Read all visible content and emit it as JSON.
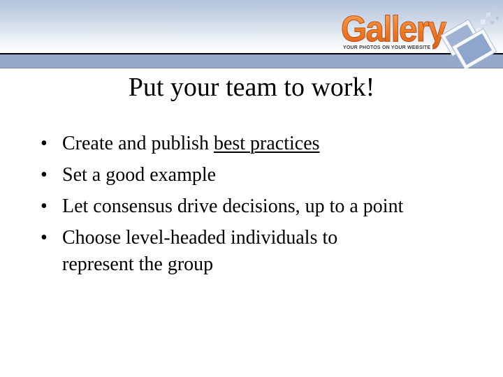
{
  "header": {
    "logo": {
      "name": "Gallery",
      "tagline": "YOUR PHOTOS ON YOUR WEBSITE",
      "icon": "photo-stack-icon"
    },
    "colors": {
      "gradient_top": "#b3c3db",
      "band": "#95a9cc",
      "rule": "#000000",
      "logo_orange": "#f07a22"
    }
  },
  "slide": {
    "title": "Put your team to work!",
    "bullets": [
      {
        "bullet": "•",
        "before": "Create and publish ",
        "link": "best practices",
        "after": ""
      },
      {
        "bullet": "•",
        "text": "Set a good example"
      },
      {
        "bullet": "•",
        "text": "Let consensus drive decisions, up to a point"
      },
      {
        "bullet": "•",
        "text": "Choose level-headed individuals to",
        "continuation": "represent the group"
      }
    ]
  }
}
